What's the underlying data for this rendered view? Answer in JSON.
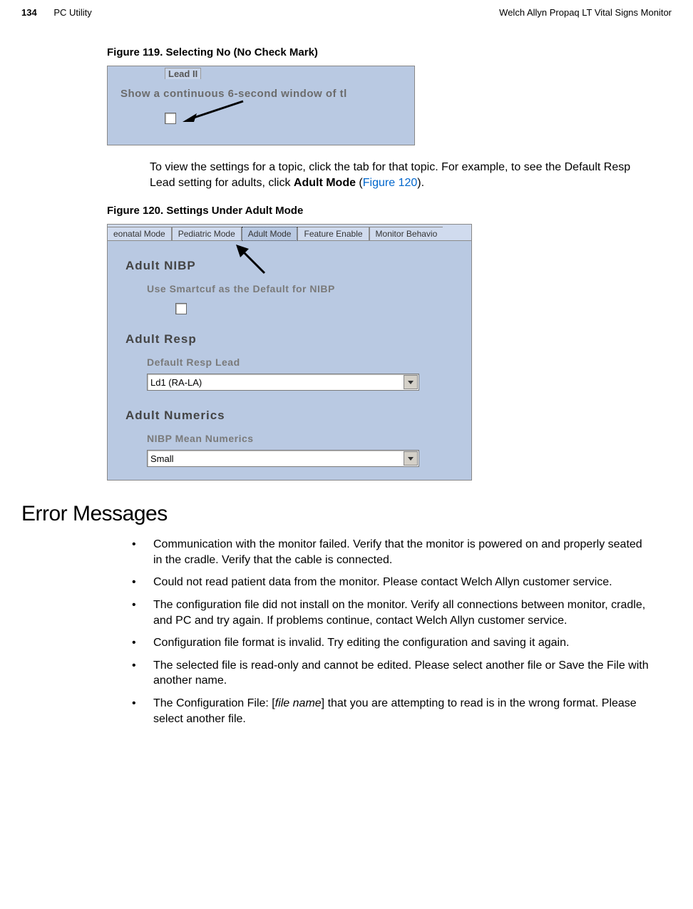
{
  "header": {
    "page_num": "134",
    "section": "PC Utility",
    "product": "Welch Allyn Propaq LT Vital Signs Monitor"
  },
  "fig119": {
    "caption": "Figure 119.  Selecting No (No Check Mark)",
    "lead": "Lead II",
    "show": "Show a continuous 6-second window of tl"
  },
  "para1": {
    "text1": "To view the settings for a topic, click the tab for that topic. For example, to see the Default Resp Lead setting for adults, click ",
    "bold": "Adult Mode",
    "text2": " (",
    "link": "Figure 120",
    "text3": ")."
  },
  "fig120": {
    "caption": "Figure 120.  Settings Under Adult Mode",
    "tabs": {
      "neonatal": "eonatal Mode",
      "pediatric": "Pediatric Mode",
      "adult": "Adult Mode",
      "feature": "Feature Enable",
      "monitor": "Monitor Behavio"
    },
    "h_nibp": "Adult  NIBP",
    "sub_nibp": "Use  Smartcuf  as  the  Default  for  NIBP",
    "h_resp": "Adult  Resp",
    "sub_resp": "Default Resp Lead",
    "dd_resp": "Ld1 (RA-LA)",
    "h_num": "Adult Numerics",
    "sub_num": "NIBP  Mean  Numerics",
    "dd_num": "Small"
  },
  "err_heading": "Error Messages",
  "errs": {
    "e1": "Communication with the monitor failed. Verify that the monitor is powered on and properly seated in the cradle. Verify that the cable is connected.",
    "e2": "Could not read patient data from the monitor. Please contact Welch Allyn customer service.",
    "e3": "The configuration file did not install on the monitor. Verify all connections between monitor, cradle, and PC and try again. If problems continue, contact Welch Allyn customer service.",
    "e4": "Configuration file format is invalid. Try editing the configuration and saving it again.",
    "e5": "The selected file is read-only and cannot be edited. Please select another file or Save the File with another name.",
    "e6a": "The Configuration File: [",
    "e6i": "file name",
    "e6b": "] that you are attempting to read is in the wrong format. Please select another file."
  }
}
